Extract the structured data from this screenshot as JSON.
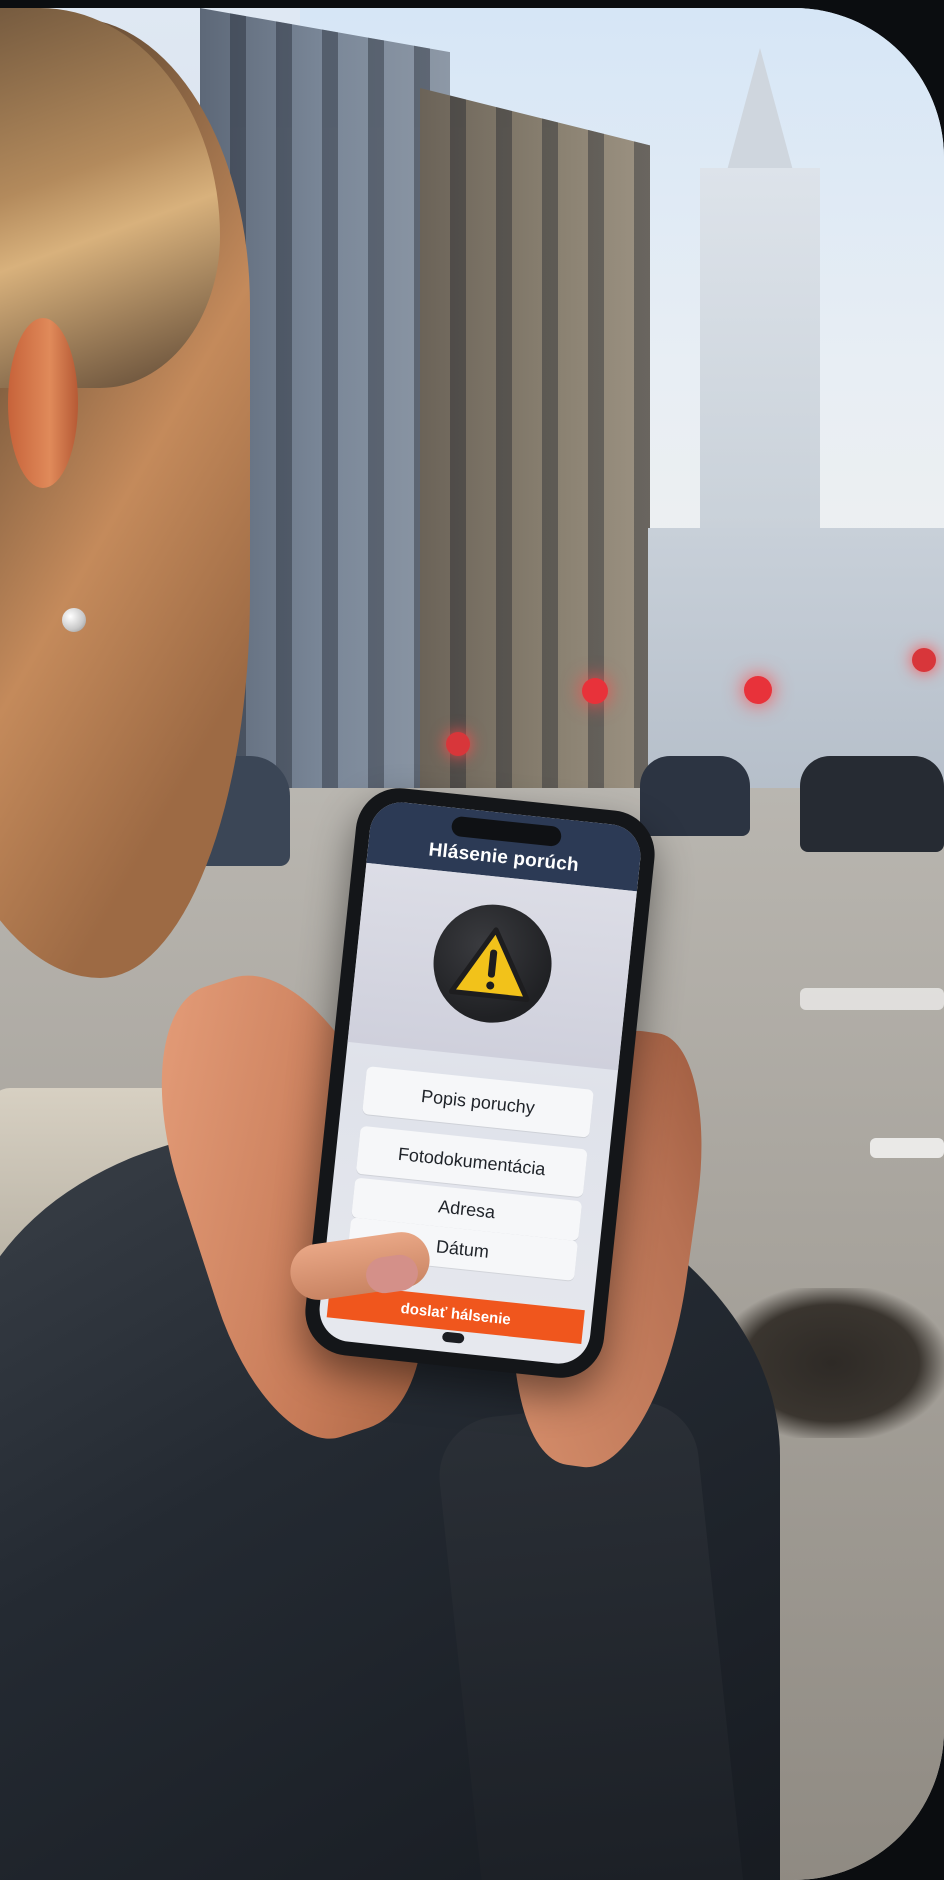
{
  "scene": {
    "description_icon": "warning-triangle-icon"
  },
  "app": {
    "header_title": "Hlásenie porúch",
    "fields": [
      {
        "label": "Popis poruchy"
      },
      {
        "label": "Fotodokumentácia"
      },
      {
        "label": "Adresa"
      },
      {
        "label": "Dátum"
      }
    ],
    "submit_label": "doslať hálsenie"
  },
  "colors": {
    "header": "#2c3a55",
    "accent": "#f0561d",
    "warning_yellow": "#f2c21a",
    "warning_circle": "#202124"
  }
}
